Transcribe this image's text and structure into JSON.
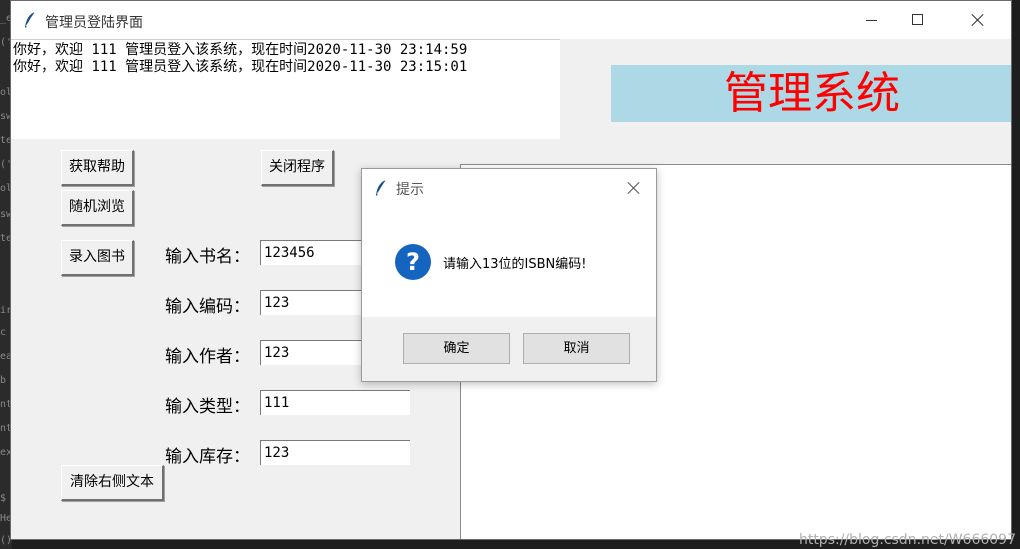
{
  "window": {
    "title": "管理员登陆界面"
  },
  "log": {
    "lines": [
      "你好，欢迎 111 管理员登入该系统，现在时间2020-11-30 23:14:59",
      "你好，欢迎 111 管理员登入该系统，现在时间2020-11-30 23:15:01"
    ]
  },
  "banner": {
    "text": "管理系统",
    "background": "#add8e6",
    "color": "#ff0000"
  },
  "buttons": {
    "help": "获取帮助",
    "close_program": "关闭程序",
    "random_browse": "随机浏览",
    "add_book": "录入图书",
    "clear_right": "清除右侧文本"
  },
  "form": {
    "fields": [
      {
        "label": "输入书名：",
        "value": "123456"
      },
      {
        "label": "输入编码：",
        "value": "123"
      },
      {
        "label": "输入作者：",
        "value": "123"
      },
      {
        "label": "输入类型：",
        "value": "111"
      },
      {
        "label": "输入库存：",
        "value": "123"
      }
    ]
  },
  "dialog": {
    "title": "提示",
    "icon": "question-icon",
    "icon_glyph": "?",
    "message": "请输入13位的ISBN编码!",
    "ok_label": "确定",
    "cancel_label": "取消"
  },
  "watermark": "https://blog.csdn.net/W666097",
  "ide_gutter": [
    "_e",
    "('",
    "ols",
    "sw",
    "te",
    "('",
    "ols",
    "sw",
    "te",
    "ir",
    "c",
    "ea",
    "b",
    "nt",
    "nt",
    "ex",
    "$",
    "He",
    "()"
  ]
}
